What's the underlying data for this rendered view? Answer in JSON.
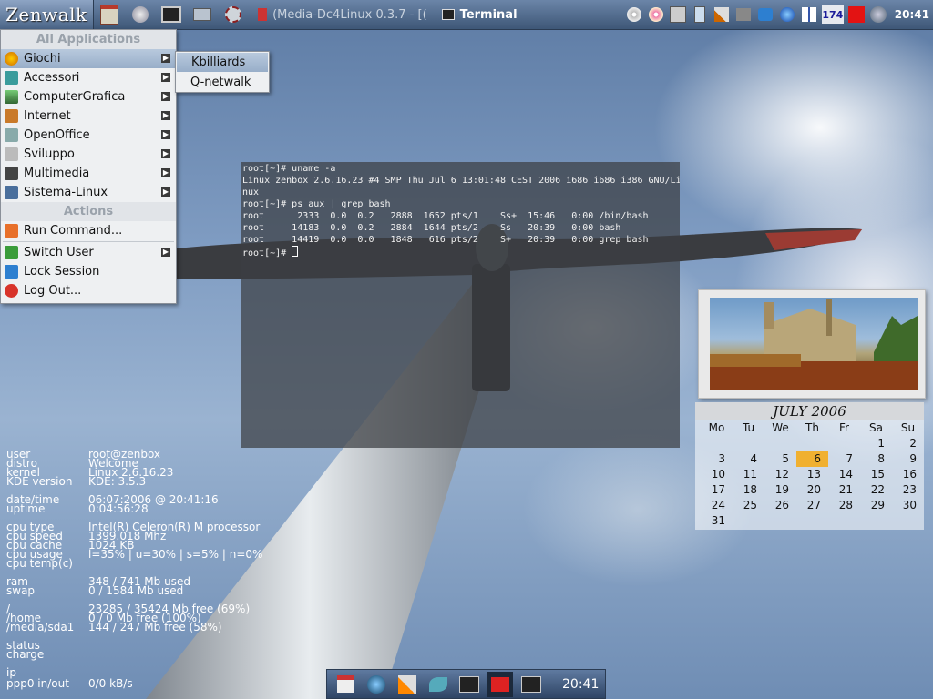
{
  "panel": {
    "logo": "Zenwalk",
    "tasks": [
      {
        "label": "(Media-Dc4Linux 0.3.7 - [("
      },
      {
        "label": "Terminal"
      }
    ],
    "tray_counter": "174",
    "clock": "20:41"
  },
  "menu": {
    "header_apps": "All Applications",
    "items": [
      {
        "label": "Giochi"
      },
      {
        "label": "Accessori"
      },
      {
        "label": "ComputerGrafica"
      },
      {
        "label": "Internet"
      },
      {
        "label": "OpenOffice"
      },
      {
        "label": "Sviluppo"
      },
      {
        "label": "Multimedia"
      },
      {
        "label": "Sistema-Linux"
      }
    ],
    "header_actions": "Actions",
    "actions": [
      {
        "label": "Run Command..."
      },
      {
        "label": "Switch User"
      },
      {
        "label": "Lock Session"
      },
      {
        "label": "Log Out..."
      }
    ],
    "submenu": [
      {
        "label": "Kbilliards"
      },
      {
        "label": "Q-netwalk"
      }
    ]
  },
  "terminal": {
    "lines": [
      "root[~]# uname -a",
      "Linux zenbox 2.6.16.23 #4 SMP Thu Jul 6 13:01:48 CEST 2006 i686 i686 i386 GNU/Li",
      "nux",
      "root[~]# ps aux | grep bash",
      "root      2333  0.0  0.2   2888  1652 pts/1    Ss+  15:46   0:00 /bin/bash",
      "root     14183  0.0  0.2   2884  1644 pts/2    Ss   20:39   0:00 bash",
      "root     14419  0.0  0.0   1848   616 pts/2    S+   20:39   0:00 grep bash"
    ],
    "prompt": "root[~]# "
  },
  "sysinfo": {
    "user": {
      "k": "user",
      "v": "root@zenbox"
    },
    "distro": {
      "k": "distro",
      "v": "Welcome"
    },
    "kernel": {
      "k": "kernel",
      "v": "Linux 2.6.16.23"
    },
    "kde": {
      "k": "KDE version",
      "v": "KDE: 3.5.3"
    },
    "datetime": {
      "k": "date/time",
      "v": "06:07:2006 @ 20:41:16"
    },
    "uptime": {
      "k": "uptime",
      "v": "0:04:56:28"
    },
    "cputype": {
      "k": "cpu type",
      "v": "Intel(R) Celeron(R) M processor"
    },
    "cpuspeed": {
      "k": "cpu speed",
      "v": "1399.018 Mhz"
    },
    "cpucache": {
      "k": "cpu cache",
      "v": "1024 KB"
    },
    "cpuusage": {
      "k": "cpu usage",
      "v": "l=35% | u=30% | s=5% | n=0%"
    },
    "cputemp": {
      "k": "cpu temp(c)",
      "v": ""
    },
    "ram": {
      "k": "ram",
      "v": "348 / 741 Mb used"
    },
    "swap": {
      "k": "swap",
      "v": "0 / 1584 Mb used"
    },
    "root": {
      "k": "/",
      "v": "23285 / 35424 Mb free (69%)"
    },
    "home": {
      "k": "/home",
      "v": "0 / 0 Mb free (100%)"
    },
    "sda1": {
      "k": "/media/sda1",
      "v": "144 / 247 Mb free (58%)"
    },
    "status": {
      "k": "status",
      "v": ""
    },
    "charge": {
      "k": "charge",
      "v": ""
    },
    "ip": {
      "k": "ip",
      "v": ""
    },
    "ppp": {
      "k": "ppp0 in/out",
      "v": "0/0 kB/s"
    }
  },
  "calendar": {
    "title": "JULY 2006",
    "days": [
      "Mo",
      "Tu",
      "We",
      "Th",
      "Fr",
      "Sa",
      "Su"
    ],
    "today": 6
  },
  "bottom_panel": {
    "clock": "20:41"
  }
}
